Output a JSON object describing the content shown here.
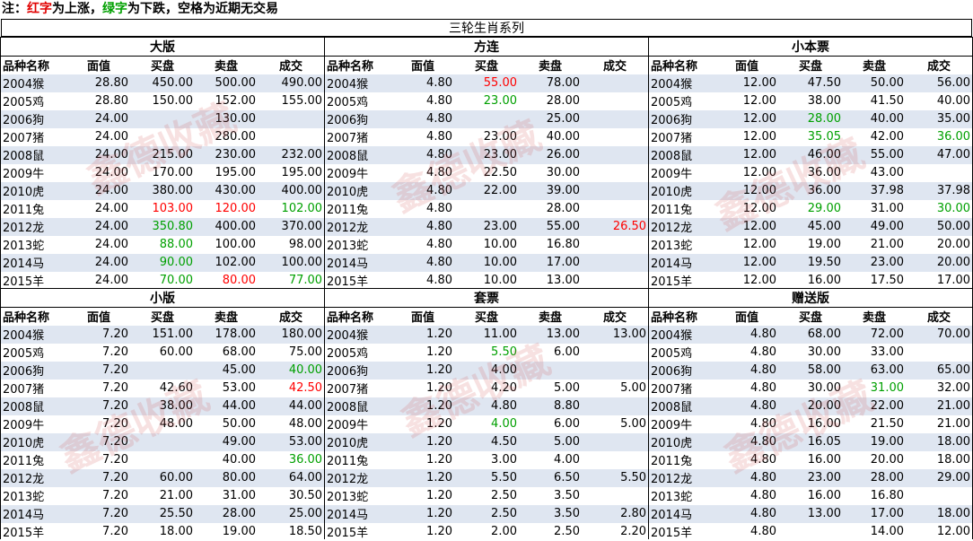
{
  "note": {
    "prefix": "注：",
    "red_word": "红字",
    "red_suffix": "为上涨，",
    "green_word": "绿字",
    "green_suffix": "为下跌，空格为近期无交易"
  },
  "title": "三轮生肖系列",
  "headers": [
    "品种名称",
    "面值",
    "买盘",
    "卖盘",
    "成交"
  ],
  "watermark": "鑫德收藏",
  "colors": {
    "up": "#ff0000",
    "down": "#00a000",
    "row_alt": "#dfe6f1"
  },
  "panels": [
    {
      "title": "大版",
      "rows": [
        {
          "name": "2004猴",
          "face": "28.80",
          "buy": "450.00",
          "sell": "500.00",
          "deal": "490.00"
        },
        {
          "name": "2005鸡",
          "face": "28.80",
          "buy": "150.00",
          "sell": "152.00",
          "deal": "155.00"
        },
        {
          "name": "2006狗",
          "face": "24.00",
          "buy": "",
          "sell": "130.00",
          "deal": ""
        },
        {
          "name": "2007猪",
          "face": "24.00",
          "buy": "",
          "sell": "280.00",
          "deal": ""
        },
        {
          "name": "2008鼠",
          "face": "24.00",
          "buy": "215.00",
          "sell": "230.00",
          "deal": "232.00"
        },
        {
          "name": "2009牛",
          "face": "24.00",
          "buy": "170.00",
          "sell": "195.00",
          "deal": "195.00"
        },
        {
          "name": "2010虎",
          "face": "24.00",
          "buy": "380.00",
          "sell": "430.00",
          "deal": "400.00"
        },
        {
          "name": "2011兔",
          "face": "24.00",
          "buy": "103.00",
          "sell": "120.00",
          "deal": "102.00",
          "buy_c": "up",
          "sell_c": "up",
          "deal_c": "down"
        },
        {
          "name": "2012龙",
          "face": "24.00",
          "buy": "350.80",
          "sell": "400.00",
          "deal": "370.00",
          "buy_c": "down"
        },
        {
          "name": "2013蛇",
          "face": "24.00",
          "buy": "88.00",
          "sell": "100.00",
          "deal": "98.00",
          "buy_c": "down"
        },
        {
          "name": "2014马",
          "face": "24.00",
          "buy": "90.00",
          "sell": "102.00",
          "deal": "100.00",
          "buy_c": "down"
        },
        {
          "name": "2015羊",
          "face": "24.00",
          "buy": "70.00",
          "sell": "80.00",
          "deal": "77.00",
          "buy_c": "down",
          "sell_c": "up",
          "deal_c": "down"
        }
      ]
    },
    {
      "title": "方连",
      "rows": [
        {
          "name": "2004猴",
          "face": "4.80",
          "buy": "55.00",
          "sell": "78.00",
          "deal": "",
          "buy_c": "up"
        },
        {
          "name": "2005鸡",
          "face": "4.80",
          "buy": "23.00",
          "sell": "28.00",
          "deal": "",
          "buy_c": "down"
        },
        {
          "name": "2006狗",
          "face": "4.80",
          "buy": "",
          "sell": "25.00",
          "deal": ""
        },
        {
          "name": "2007猪",
          "face": "4.80",
          "buy": "23.00",
          "sell": "40.00",
          "deal": ""
        },
        {
          "name": "2008鼠",
          "face": "4.80",
          "buy": "23.00",
          "sell": "26.00",
          "deal": ""
        },
        {
          "name": "2009牛",
          "face": "4.80",
          "buy": "22.50",
          "sell": "30.00",
          "deal": ""
        },
        {
          "name": "2010虎",
          "face": "4.80",
          "buy": "22.00",
          "sell": "39.00",
          "deal": ""
        },
        {
          "name": "2011兔",
          "face": "4.80",
          "buy": "",
          "sell": "28.00",
          "deal": ""
        },
        {
          "name": "2012龙",
          "face": "4.80",
          "buy": "23.00",
          "sell": "55.00",
          "deal": "26.50",
          "deal_c": "up"
        },
        {
          "name": "2013蛇",
          "face": "4.80",
          "buy": "10.00",
          "sell": "16.80",
          "deal": ""
        },
        {
          "name": "2014马",
          "face": "4.80",
          "buy": "10.00",
          "sell": "17.00",
          "deal": ""
        },
        {
          "name": "2015羊",
          "face": "4.80",
          "buy": "10.00",
          "sell": "13.00",
          "deal": ""
        }
      ]
    },
    {
      "title": "小本票",
      "rows": [
        {
          "name": "2004猴",
          "face": "12.00",
          "buy": "47.50",
          "sell": "50.00",
          "deal": "56.00"
        },
        {
          "name": "2005鸡",
          "face": "12.00",
          "buy": "38.00",
          "sell": "41.50",
          "deal": "40.00"
        },
        {
          "name": "2006狗",
          "face": "12.00",
          "buy": "28.00",
          "sell": "40.00",
          "deal": "35.00",
          "buy_c": "down"
        },
        {
          "name": "2007猪",
          "face": "12.00",
          "buy": "35.05",
          "sell": "42.00",
          "deal": "36.00",
          "buy_c": "down",
          "deal_c": "down"
        },
        {
          "name": "2008鼠",
          "face": "12.00",
          "buy": "46.00",
          "sell": "55.00",
          "deal": "47.00"
        },
        {
          "name": "2009牛",
          "face": "12.00",
          "buy": "36.00",
          "sell": "43.00",
          "deal": ""
        },
        {
          "name": "2010虎",
          "face": "12.00",
          "buy": "36.00",
          "sell": "37.98",
          "deal": "37.98"
        },
        {
          "name": "2011兔",
          "face": "12.00",
          "buy": "29.00",
          "sell": "31.00",
          "deal": "30.00",
          "buy_c": "down",
          "deal_c": "down"
        },
        {
          "name": "2012龙",
          "face": "12.00",
          "buy": "45.00",
          "sell": "49.00",
          "deal": "50.00"
        },
        {
          "name": "2013蛇",
          "face": "12.00",
          "buy": "19.00",
          "sell": "21.00",
          "deal": "20.00"
        },
        {
          "name": "2014马",
          "face": "12.00",
          "buy": "19.50",
          "sell": "23.00",
          "deal": "20.00"
        },
        {
          "name": "2015羊",
          "face": "12.00",
          "buy": "16.00",
          "sell": "17.50",
          "deal": "17.00"
        }
      ]
    },
    {
      "title": "小版",
      "rows": [
        {
          "name": "2004猴",
          "face": "7.20",
          "buy": "151.00",
          "sell": "178.00",
          "deal": "180.00"
        },
        {
          "name": "2005鸡",
          "face": "7.20",
          "buy": "60.00",
          "sell": "68.00",
          "deal": "75.00"
        },
        {
          "name": "2006狗",
          "face": "7.20",
          "buy": "",
          "sell": "45.00",
          "deal": "40.00",
          "deal_c": "down"
        },
        {
          "name": "2007猪",
          "face": "7.20",
          "buy": "42.60",
          "sell": "53.00",
          "deal": "42.50",
          "deal_c": "up"
        },
        {
          "name": "2008鼠",
          "face": "7.20",
          "buy": "38.00",
          "sell": "44.00",
          "deal": "44.00"
        },
        {
          "name": "2009牛",
          "face": "7.20",
          "buy": "48.00",
          "sell": "50.00",
          "deal": "48.00"
        },
        {
          "name": "2010虎",
          "face": "7.20",
          "buy": "",
          "sell": "49.00",
          "deal": "53.00"
        },
        {
          "name": "2011兔",
          "face": "7.20",
          "buy": "",
          "sell": "40.00",
          "deal": "36.00",
          "deal_c": "down"
        },
        {
          "name": "2012龙",
          "face": "7.20",
          "buy": "60.00",
          "sell": "80.00",
          "deal": "64.00"
        },
        {
          "name": "2013蛇",
          "face": "7.20",
          "buy": "21.00",
          "sell": "31.00",
          "deal": "30.50"
        },
        {
          "name": "2014马",
          "face": "7.20",
          "buy": "25.50",
          "sell": "28.00",
          "deal": "25.00"
        },
        {
          "name": "2015羊",
          "face": "7.20",
          "buy": "18.00",
          "sell": "19.00",
          "deal": "18.50"
        }
      ]
    },
    {
      "title": "套票",
      "rows": [
        {
          "name": "2004猴",
          "face": "1.20",
          "buy": "11.00",
          "sell": "13.00",
          "deal": "13.00"
        },
        {
          "name": "2005鸡",
          "face": "1.20",
          "buy": "5.50",
          "sell": "6.00",
          "deal": "",
          "buy_c": "down"
        },
        {
          "name": "2006狗",
          "face": "1.20",
          "buy": "4.00",
          "sell": "",
          "deal": ""
        },
        {
          "name": "2007猪",
          "face": "1.20",
          "buy": "4.20",
          "sell": "5.00",
          "deal": "5.00"
        },
        {
          "name": "2008鼠",
          "face": "1.20",
          "buy": "4.80",
          "sell": "8.80",
          "deal": ""
        },
        {
          "name": "2009牛",
          "face": "1.20",
          "buy": "4.00",
          "sell": "6.00",
          "deal": "5.00",
          "buy_c": "down"
        },
        {
          "name": "2010虎",
          "face": "1.20",
          "buy": "4.50",
          "sell": "5.00",
          "deal": ""
        },
        {
          "name": "2011兔",
          "face": "1.20",
          "buy": "3.00",
          "sell": "4.00",
          "deal": ""
        },
        {
          "name": "2012龙",
          "face": "1.20",
          "buy": "5.50",
          "sell": "6.50",
          "deal": "5.50"
        },
        {
          "name": "2013蛇",
          "face": "1.20",
          "buy": "2.50",
          "sell": "3.50",
          "deal": ""
        },
        {
          "name": "2014马",
          "face": "1.20",
          "buy": "2.50",
          "sell": "3.50",
          "deal": "2.80"
        },
        {
          "name": "2015羊",
          "face": "1.20",
          "buy": "2.00",
          "sell": "2.50",
          "deal": "2.20"
        }
      ]
    },
    {
      "title": "赠送版",
      "rows": [
        {
          "name": "2004猴",
          "face": "4.80",
          "buy": "68.00",
          "sell": "72.00",
          "deal": "70.00"
        },
        {
          "name": "2005鸡",
          "face": "4.80",
          "buy": "30.00",
          "sell": "33.00",
          "deal": ""
        },
        {
          "name": "2006狗",
          "face": "4.80",
          "buy": "58.00",
          "sell": "63.00",
          "deal": "65.00"
        },
        {
          "name": "2007猪",
          "face": "4.80",
          "buy": "30.00",
          "sell": "31.00",
          "deal": "32.00",
          "sell_c": "down"
        },
        {
          "name": "2008鼠",
          "face": "4.80",
          "buy": "20.00",
          "sell": "22.00",
          "deal": "21.00"
        },
        {
          "name": "2009牛",
          "face": "4.80",
          "buy": "16.00",
          "sell": "21.50",
          "deal": "21.00"
        },
        {
          "name": "2010虎",
          "face": "4.80",
          "buy": "16.05",
          "sell": "19.00",
          "deal": "18.00"
        },
        {
          "name": "2011兔",
          "face": "4.80",
          "buy": "16.00",
          "sell": "20.00",
          "deal": "18.00"
        },
        {
          "name": "2012龙",
          "face": "4.80",
          "buy": "23.00",
          "sell": "28.00",
          "deal": "29.00"
        },
        {
          "name": "2013蛇",
          "face": "4.80",
          "buy": "16.00",
          "sell": "16.80",
          "deal": ""
        },
        {
          "name": "2014马",
          "face": "4.80",
          "buy": "13.00",
          "sell": "17.00",
          "deal": "18.00"
        },
        {
          "name": "2015羊",
          "face": "4.80",
          "buy": "",
          "sell": "14.00",
          "deal": "12.00"
        }
      ]
    }
  ]
}
